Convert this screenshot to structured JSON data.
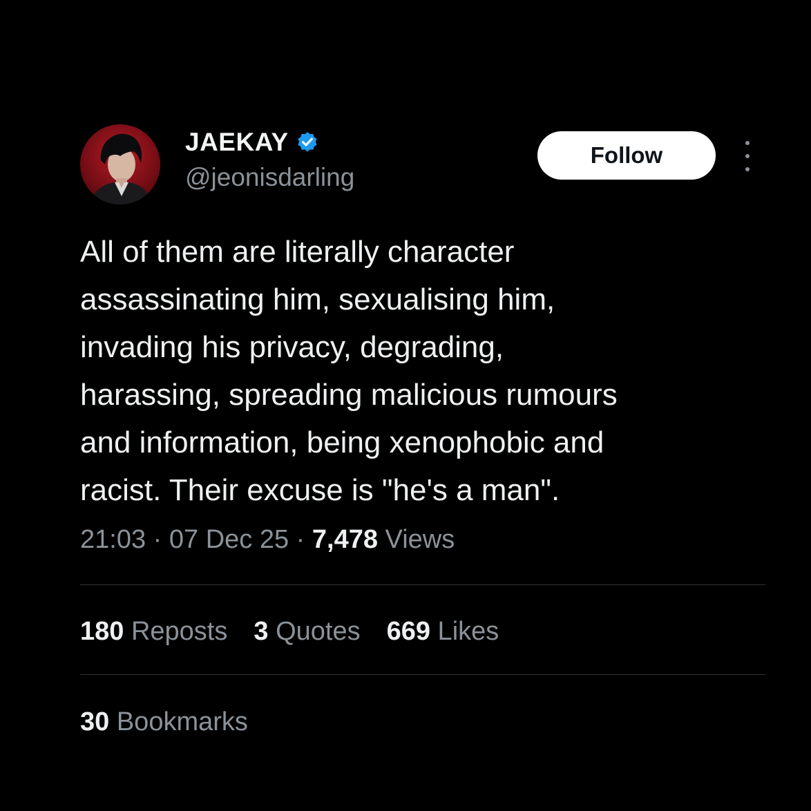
{
  "author": {
    "display_name": "JAEKAY",
    "handle": "@jeonisdarling",
    "verified": true,
    "verified_color": "#1d9bf0",
    "avatar_icon": "profile-photo"
  },
  "actions": {
    "follow_label": "Follow",
    "more_icon": "more-vertical-icon"
  },
  "tweet": {
    "lines": [
      "All of them are literally character",
      "assassinating him, sexualising him,",
      "invading his privacy, degrading,",
      "harassing, spreading malicious rumours",
      "and information, being xenophobic and",
      "racist. Their excuse is \"he's a man\"."
    ]
  },
  "meta": {
    "time": "21:03",
    "sep1": " · ",
    "date": "07 Dec 25",
    "sep2": " · ",
    "views_count": "7,478",
    "views_label": " Views"
  },
  "stats": [
    {
      "count": "180",
      "label": " Reposts"
    },
    {
      "count": "3",
      "label": " Quotes"
    },
    {
      "count": "669",
      "label": " Likes"
    }
  ],
  "bookmarks": {
    "count": "30",
    "label": " Bookmarks"
  },
  "colors": {
    "background": "#000000",
    "text_primary": "#eef0f1",
    "text_secondary": "#8b9299",
    "divider": "#2f3336",
    "button_bg": "#ffffff"
  }
}
